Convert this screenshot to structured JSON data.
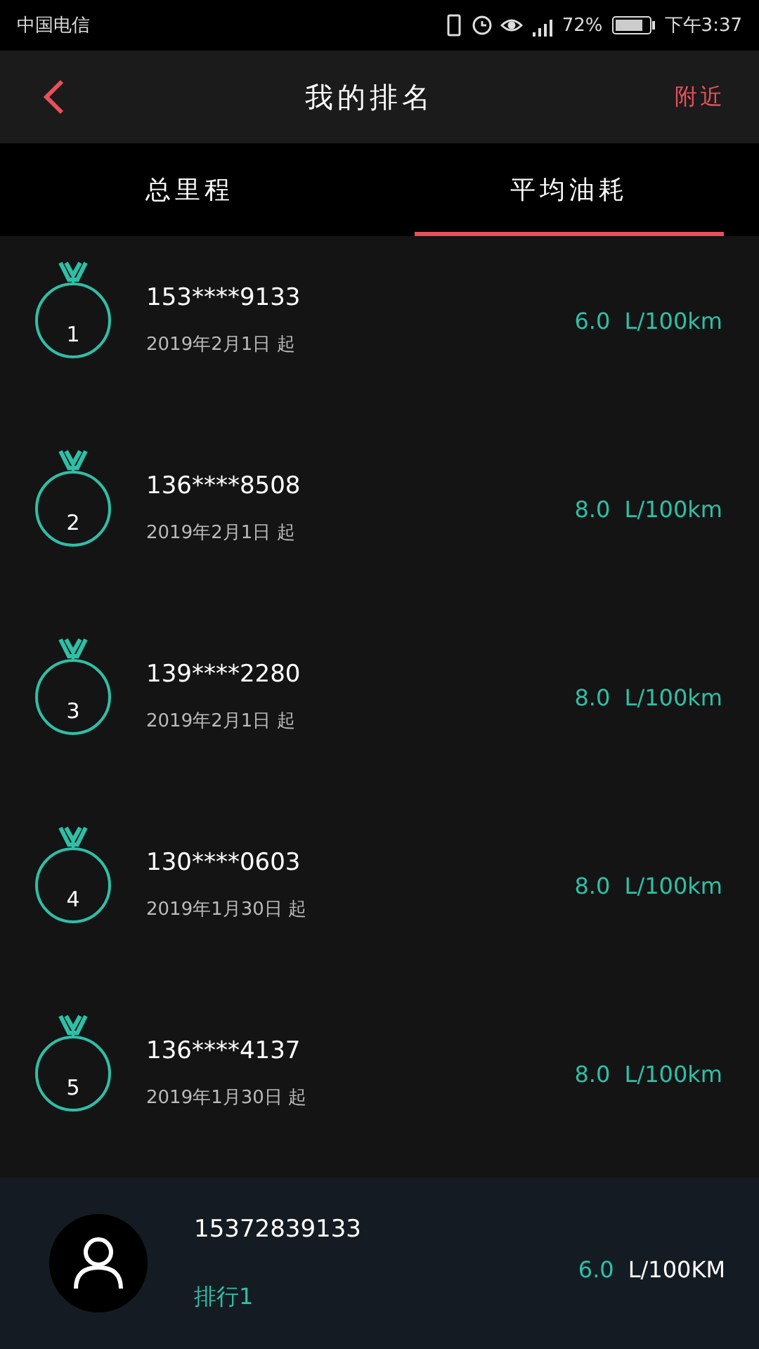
{
  "status_bar": {
    "carrier": "中国电信",
    "battery": "72%",
    "time": "下午3:37"
  },
  "header": {
    "title": "我的排名",
    "action": "附近"
  },
  "tabs": [
    {
      "label": "总里程",
      "selected": false
    },
    {
      "label": "平均油耗",
      "selected": true
    }
  ],
  "rankings": [
    {
      "rank": "1",
      "phone": "153****9133",
      "since": "2019年2月1日 起",
      "value": "6.0  L/100km"
    },
    {
      "rank": "2",
      "phone": "136****8508",
      "since": "2019年2月1日 起",
      "value": "8.0  L/100km"
    },
    {
      "rank": "3",
      "phone": "139****2280",
      "since": "2019年2月1日 起",
      "value": "8.0  L/100km"
    },
    {
      "rank": "4",
      "phone": "130****0603",
      "since": "2019年1月30日 起",
      "value": "8.0  L/100km"
    },
    {
      "rank": "5",
      "phone": "136****4137",
      "since": "2019年1月30日 起",
      "value": "8.0  L/100km"
    }
  ],
  "my_rank": {
    "phone": "15372839133",
    "rank_label": "排行1",
    "value": "6.0",
    "unit": "L/100KM"
  }
}
